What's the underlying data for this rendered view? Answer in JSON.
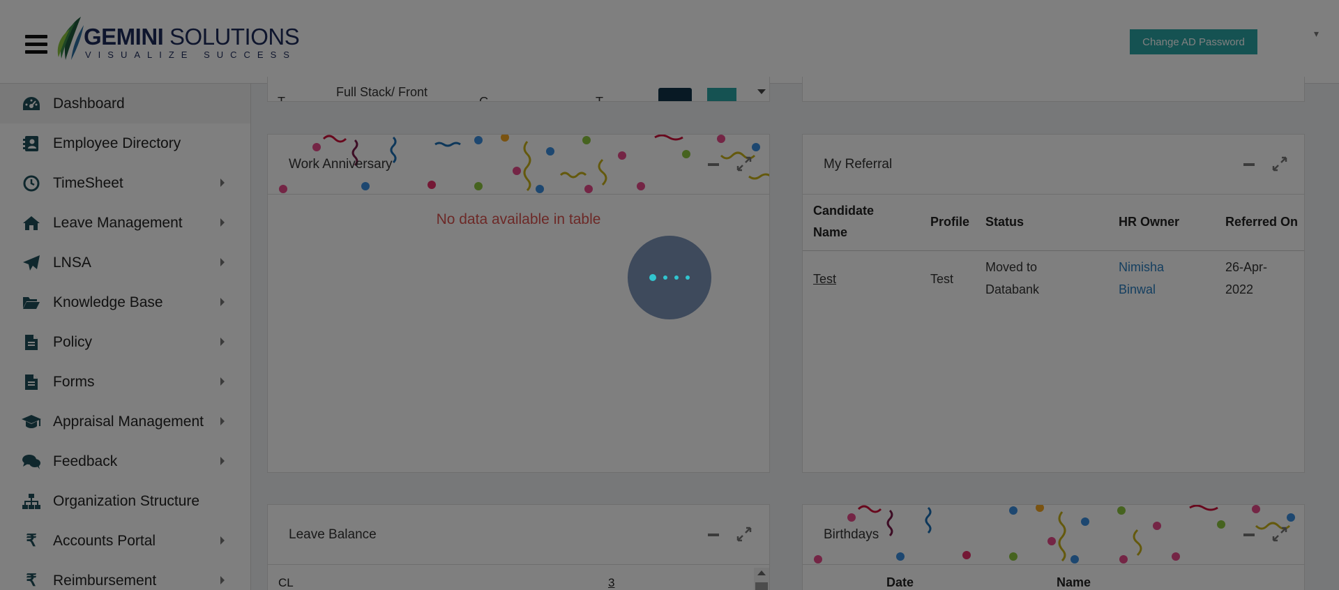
{
  "header": {
    "brand_name_bold": "GEMINI",
    "brand_name_rest": " SOLUTIONS",
    "tagline": "VISUALIZE SUCCESS",
    "change_password_label": "Change AD Password",
    "menu_icon": "hamburger-icon",
    "user_menu_icon": "caret-down-icon"
  },
  "sidebar": {
    "items": [
      {
        "label": "Dashboard",
        "icon": "dashboard-icon",
        "has_submenu": false,
        "active": true
      },
      {
        "label": "Employee Directory",
        "icon": "address-book-icon",
        "has_submenu": false
      },
      {
        "label": "TimeSheet",
        "icon": "clock-icon",
        "has_submenu": true
      },
      {
        "label": "Leave Management",
        "icon": "home-icon",
        "has_submenu": true
      },
      {
        "label": "LNSA",
        "icon": "paper-plane-icon",
        "has_submenu": true
      },
      {
        "label": "Knowledge Base",
        "icon": "folder-open-icon",
        "has_submenu": true
      },
      {
        "label": "Policy",
        "icon": "document-icon",
        "has_submenu": true
      },
      {
        "label": "Forms",
        "icon": "document-icon",
        "has_submenu": true
      },
      {
        "label": "Appraisal Management",
        "icon": "graduation-cap-icon",
        "has_submenu": true
      },
      {
        "label": "Feedback",
        "icon": "comments-icon",
        "has_submenu": true
      },
      {
        "label": "Organization Structure",
        "icon": "sitemap-icon",
        "has_submenu": false
      },
      {
        "label": "Accounts Portal",
        "icon": "rupee-icon",
        "has_submenu": true
      },
      {
        "label": "Reimbursement",
        "icon": "rupee-icon",
        "has_submenu": true
      }
    ]
  },
  "top_card": {
    "col1_fragment": "T",
    "col2_fragment": "Full Stack/ Front",
    "col3_fragment": "G",
    "col4_fragment": "T"
  },
  "work_anniversary": {
    "title": "Work Anniversary",
    "empty_message": "No data available in table"
  },
  "my_referral": {
    "title": "My Referral",
    "columns": [
      "Candidate Name",
      "Profile",
      "Status",
      "HR Owner",
      "Referred On"
    ],
    "rows": [
      {
        "candidate": "Test",
        "profile": "Test",
        "status": "Moved to Databank",
        "hr_owner": "Nimisha Binwal",
        "referred_on": "26-Apr-2022"
      }
    ]
  },
  "leave_balance": {
    "title": "Leave Balance",
    "rows": [
      {
        "type": "CL",
        "value": "3"
      }
    ]
  },
  "birthdays": {
    "title": "Birthdays",
    "columns": [
      "Date",
      "Name"
    ]
  },
  "colors": {
    "accent": "#2ba5a5",
    "brand_navy": "#1d2b5a",
    "error_text": "#d9534f",
    "link": "#2a7ec1",
    "loader_dot": "#31c5cf"
  }
}
